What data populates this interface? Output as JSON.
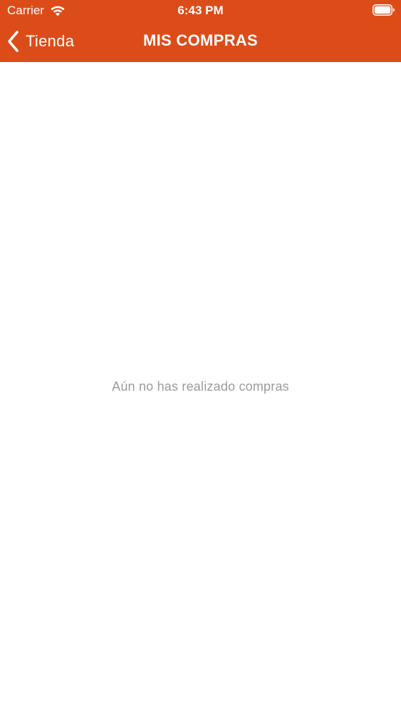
{
  "status_bar": {
    "carrier": "Carrier",
    "time": "6:43 PM",
    "wifi_icon": "wifi-icon",
    "battery_icon": "battery-icon"
  },
  "nav_bar": {
    "back_label": "Tienda",
    "back_icon": "chevron-left-icon",
    "title": "MIS COMPRAS"
  },
  "content": {
    "empty_message": "Aún no has realizado compras"
  },
  "colors": {
    "accent": "#DC4C19",
    "background": "#FFFFFF",
    "empty_text": "#9B9B9B"
  }
}
